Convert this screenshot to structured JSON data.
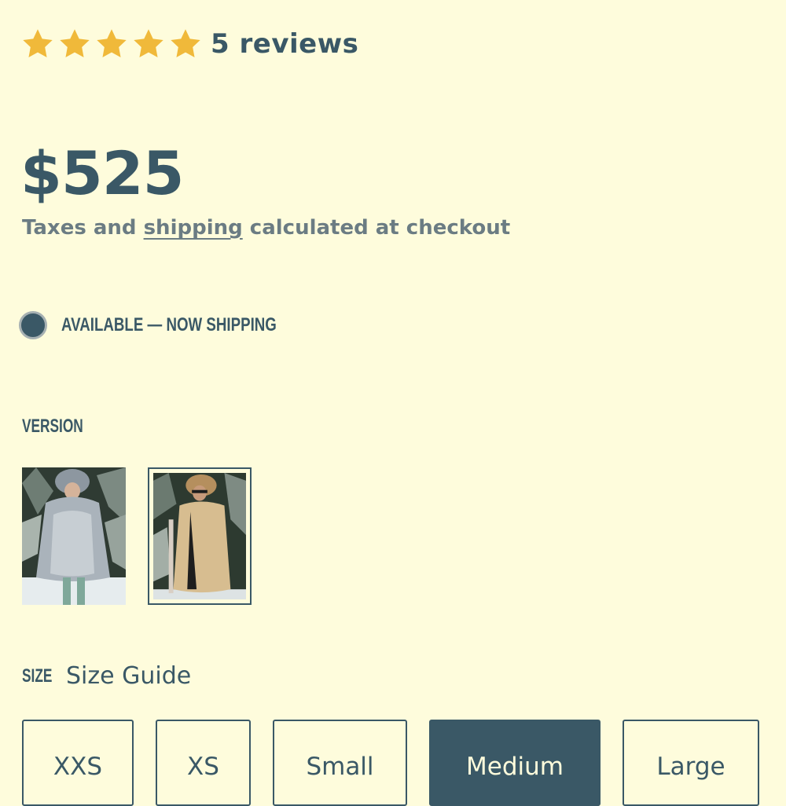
{
  "rating": {
    "stars": 5,
    "max_stars": 5,
    "reviews_label": "5 reviews"
  },
  "price": "$525",
  "tax_note": {
    "prefix": "Taxes and ",
    "link": "shipping",
    "suffix": " calculated at checkout"
  },
  "availability": {
    "text": "AVAILABLE — NOW SHIPPING"
  },
  "version": {
    "label": "VERSION",
    "options": [
      {
        "name": "grey-coat",
        "selected": false
      },
      {
        "name": "tan-coat",
        "selected": true
      }
    ]
  },
  "size": {
    "label": "SIZE",
    "guide_label": "Size Guide",
    "options": [
      {
        "label": "XXS",
        "selected": false
      },
      {
        "label": "XS",
        "selected": false
      },
      {
        "label": "Small",
        "selected": false
      },
      {
        "label": "Medium",
        "selected": true
      },
      {
        "label": "Large",
        "selected": false
      }
    ]
  },
  "colors": {
    "background": "#fefcdc",
    "primary": "#3a5866",
    "star": "#f0b93a",
    "muted_text": "#6b7c83"
  }
}
